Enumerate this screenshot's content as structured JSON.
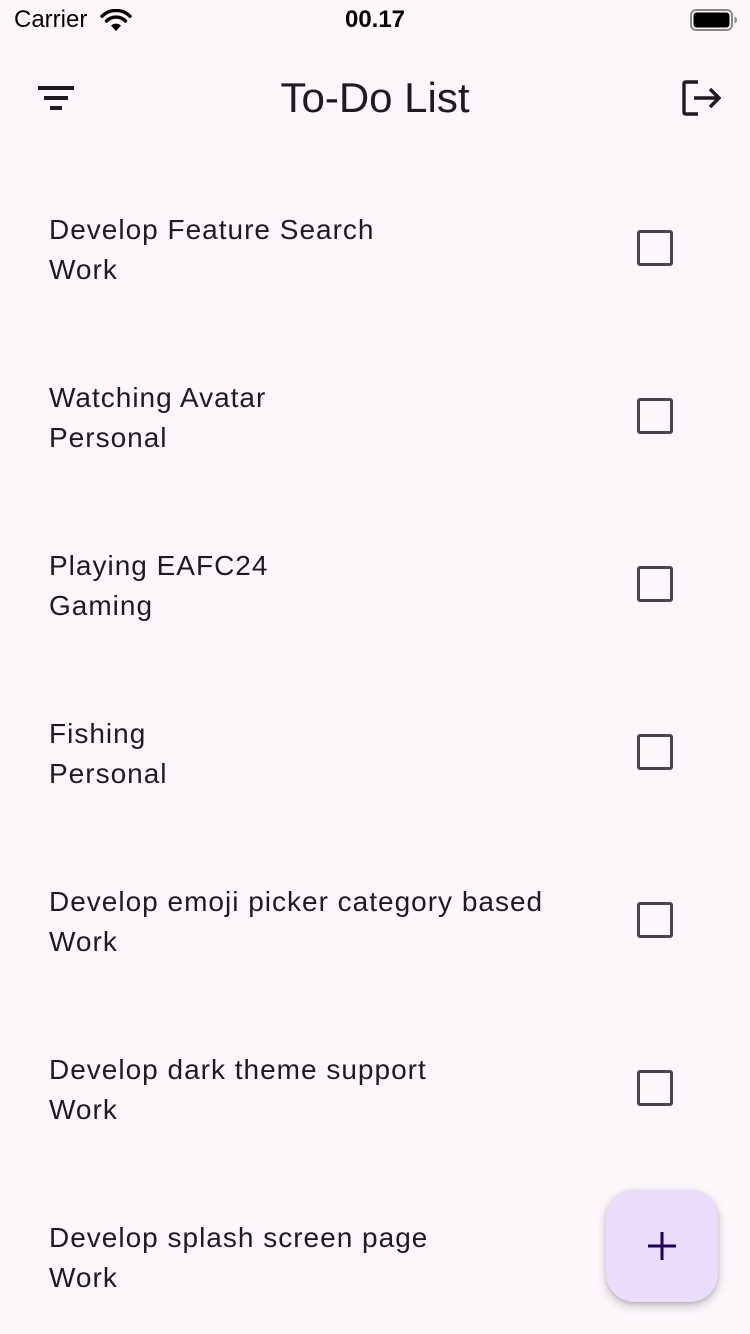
{
  "status_bar": {
    "carrier": "Carrier",
    "time": "00.17"
  },
  "app_bar": {
    "title": "To-Do List",
    "left_icon": "filter-icon",
    "right_icon": "logout-icon"
  },
  "todos": [
    {
      "title": "Develop Feature Search",
      "category": "Work",
      "checked": false
    },
    {
      "title": "Watching Avatar",
      "category": "Personal",
      "checked": false
    },
    {
      "title": "Playing EAFC24",
      "category": "Gaming",
      "checked": false
    },
    {
      "title": "Fishing",
      "category": "Personal",
      "checked": false
    },
    {
      "title": "Develop emoji picker category based",
      "category": "Work",
      "checked": false
    },
    {
      "title": "Develop dark theme support",
      "category": "Work",
      "checked": false
    },
    {
      "title": "Develop splash screen page",
      "category": "Work",
      "checked": false
    }
  ],
  "fab": {
    "icon": "plus-icon"
  },
  "colors": {
    "background": "#fdf7fc",
    "fab_background": "#eaddfb",
    "fab_icon": "#21005d",
    "text": "#1d1b20"
  }
}
